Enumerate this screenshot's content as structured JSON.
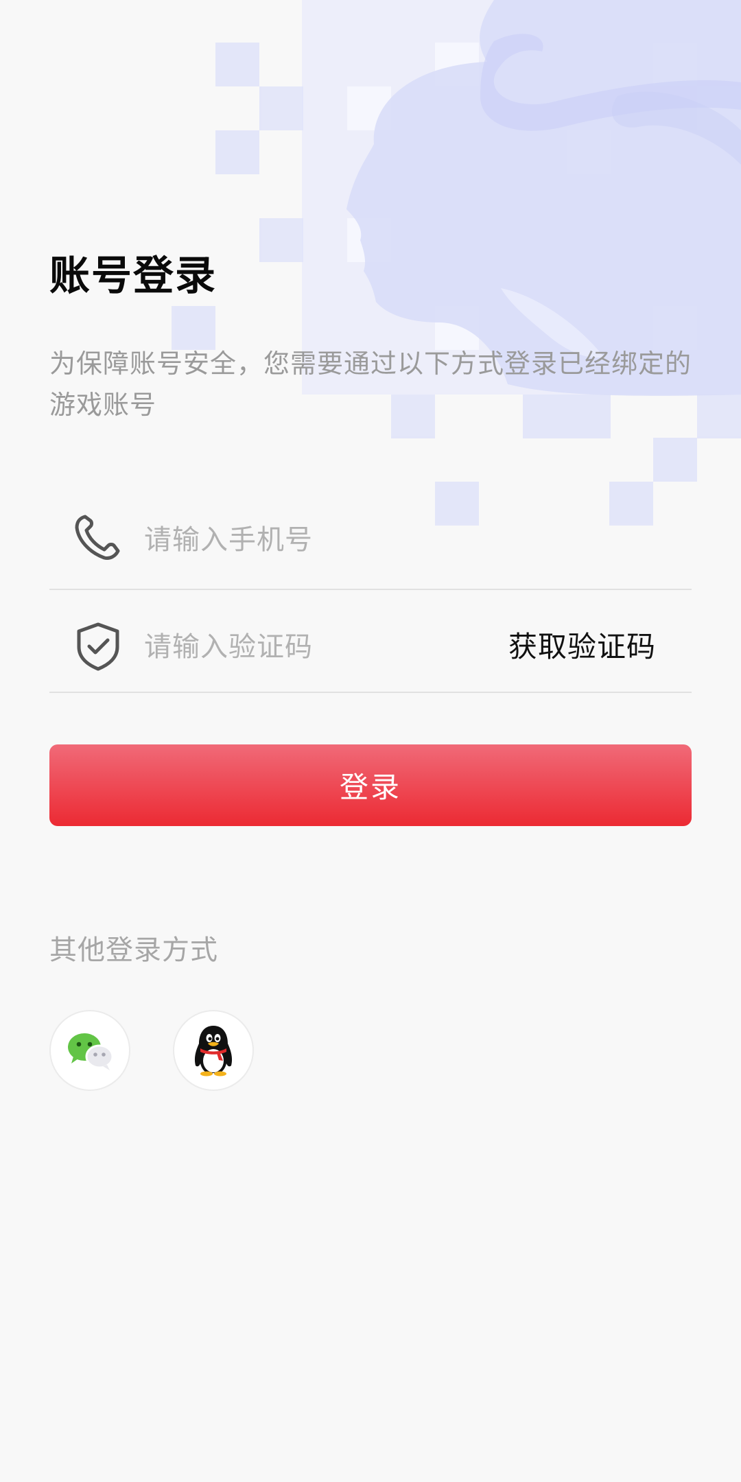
{
  "page": {
    "title": "账号登录",
    "description": "为保障账号安全，您需要通过以下方式登录已经绑定的游戏账号"
  },
  "form": {
    "phone": {
      "placeholder": "请输入手机号",
      "value": "",
      "icon": "phone-icon"
    },
    "code": {
      "placeholder": "请输入验证码",
      "value": "",
      "icon": "shield-check-icon",
      "get_code_label": "获取验证码"
    },
    "login_label": "登录"
  },
  "other_login": {
    "label": "其他登录方式",
    "options": [
      {
        "name": "wechat",
        "icon": "wechat-icon"
      },
      {
        "name": "qq",
        "icon": "qq-icon"
      }
    ]
  },
  "colors": {
    "background": "#f8f8f8",
    "accent_top": "#f06a78",
    "accent_bottom": "#ec2a33",
    "decor": "#dee2fb",
    "placeholder": "#b1b1b1"
  }
}
